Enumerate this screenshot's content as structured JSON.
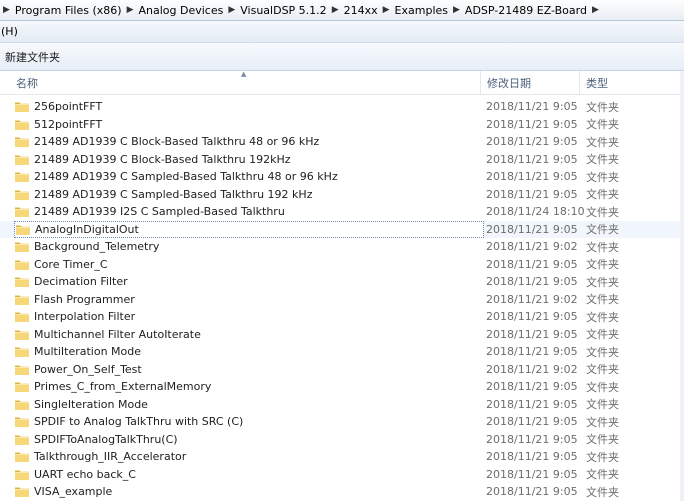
{
  "address": {
    "segments": [
      "Program Files (x86)",
      "Analog Devices",
      "VisualDSP 5.1.2",
      "214xx",
      "Examples",
      "ADSP-21489 EZ-Board"
    ]
  },
  "menu": {
    "help_label": "(H)"
  },
  "toolbar": {
    "new_folder_label": "新建文件夹"
  },
  "columns": {
    "name": "名称",
    "date": "修改日期",
    "type": "类型"
  },
  "files": [
    {
      "name": "256pointFFT",
      "date": "2018/11/21 9:05",
      "type": "文件夹"
    },
    {
      "name": "512pointFFT",
      "date": "2018/11/21 9:05",
      "type": "文件夹"
    },
    {
      "name": "21489 AD1939 C Block-Based Talkthru 48 or 96 kHz",
      "date": "2018/11/21 9:05",
      "type": "文件夹"
    },
    {
      "name": "21489 AD1939 C Block-Based Talkthru 192kHz",
      "date": "2018/11/21 9:05",
      "type": "文件夹"
    },
    {
      "name": "21489 AD1939 C Sampled-Based Talkthru 48 or 96 kHz",
      "date": "2018/11/21 9:05",
      "type": "文件夹"
    },
    {
      "name": "21489 AD1939 C Sampled-Based Talkthru 192 kHz",
      "date": "2018/11/21 9:05",
      "type": "文件夹"
    },
    {
      "name": "21489 AD1939 I2S C Sampled-Based Talkthru",
      "date": "2018/11/24 18:10",
      "type": "文件夹"
    },
    {
      "name": "AnalogInDigitalOut",
      "date": "2018/11/21 9:05",
      "type": "文件夹"
    },
    {
      "name": "Background_Telemetry",
      "date": "2018/11/21 9:02",
      "type": "文件夹"
    },
    {
      "name": "Core Timer_C",
      "date": "2018/11/21 9:05",
      "type": "文件夹"
    },
    {
      "name": "Decimation Filter",
      "date": "2018/11/21 9:05",
      "type": "文件夹"
    },
    {
      "name": "Flash Programmer",
      "date": "2018/11/21 9:02",
      "type": "文件夹"
    },
    {
      "name": "Interpolation Filter",
      "date": "2018/11/21 9:05",
      "type": "文件夹"
    },
    {
      "name": "Multichannel Filter AutoIterate",
      "date": "2018/11/21 9:05",
      "type": "文件夹"
    },
    {
      "name": "MultiIteration Mode",
      "date": "2018/11/21 9:05",
      "type": "文件夹"
    },
    {
      "name": "Power_On_Self_Test",
      "date": "2018/11/21 9:02",
      "type": "文件夹"
    },
    {
      "name": "Primes_C_from_ExternalMemory",
      "date": "2018/11/21 9:05",
      "type": "文件夹"
    },
    {
      "name": "SingleIteration Mode",
      "date": "2018/11/21 9:05",
      "type": "文件夹"
    },
    {
      "name": "SPDIF to Analog TalkThru with SRC (C)",
      "date": "2018/11/21 9:05",
      "type": "文件夹"
    },
    {
      "name": "SPDIFToAnalogTalkThru(C)",
      "date": "2018/11/21 9:05",
      "type": "文件夹"
    },
    {
      "name": "Talkthrough_IIR_Accelerator",
      "date": "2018/11/21 9:05",
      "type": "文件夹"
    },
    {
      "name": "UART echo back_C",
      "date": "2018/11/21 9:05",
      "type": "文件夹"
    },
    {
      "name": "VISA_example",
      "date": "2018/11/21 9:05",
      "type": "文件夹"
    }
  ],
  "selected_index": 7,
  "colors": {
    "folder": "#f2c94c",
    "selection_border": "#6d87ad",
    "header_text": "#4c607a"
  },
  "icons": {
    "folder": "folder-icon",
    "separator": "chevron-right-icon",
    "sort": "sort-up-icon"
  }
}
